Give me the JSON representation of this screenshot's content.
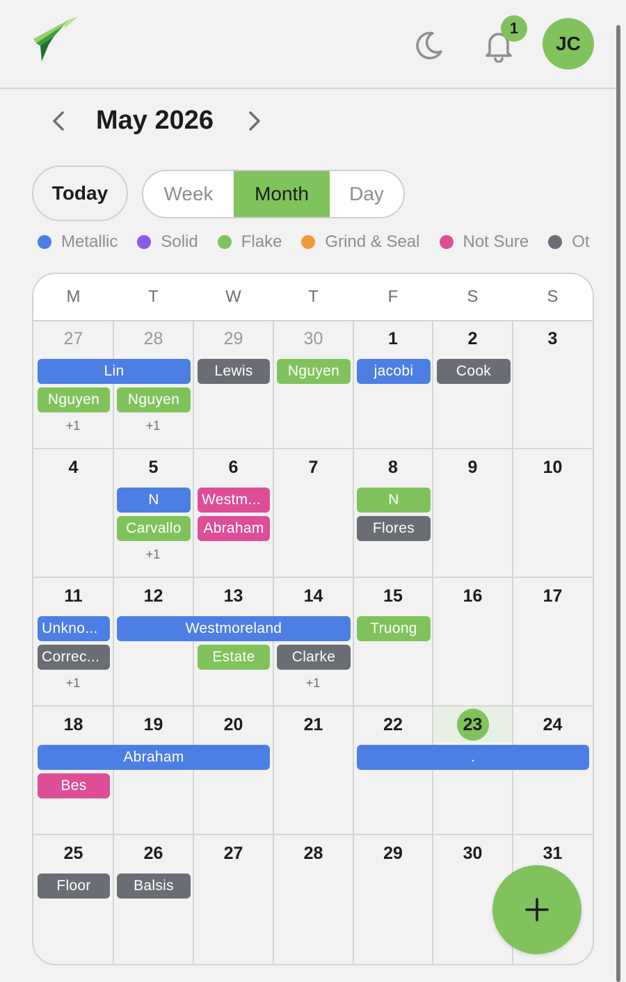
{
  "header": {
    "notification_count": "1",
    "avatar_initials": "JC"
  },
  "nav": {
    "month_title": "May 2026"
  },
  "view": {
    "today_label": "Today",
    "week_label": "Week",
    "month_label": "Month",
    "day_label": "Day",
    "selected": "Month"
  },
  "legend": [
    {
      "label": "Metallic",
      "color": "#4c7fe4"
    },
    {
      "label": "Solid",
      "color": "#8a5ce8"
    },
    {
      "label": "Flake",
      "color": "#80c35c"
    },
    {
      "label": "Grind & Seal",
      "color": "#ee9a3a"
    },
    {
      "label": "Not Sure",
      "color": "#de4e96"
    },
    {
      "label": "Ot",
      "color": "#6b6d75"
    }
  ],
  "weekdays": [
    "M",
    "T",
    "W",
    "T",
    "F",
    "S",
    "S"
  ],
  "weeks": [
    [
      "27",
      "28",
      "29",
      "30",
      "1",
      "2",
      "3"
    ],
    [
      "4",
      "5",
      "6",
      "7",
      "8",
      "9",
      "10"
    ],
    [
      "11",
      "12",
      "13",
      "14",
      "15",
      "16",
      "17"
    ],
    [
      "18",
      "19",
      "20",
      "21",
      "22",
      "23",
      "24"
    ],
    [
      "25",
      "26",
      "27",
      "28",
      "29",
      "30",
      "31"
    ]
  ],
  "today": "23",
  "events": {
    "w1_lin": "Lin",
    "w1_lewis": "Lewis",
    "w1_nguyen_thu": "Nguyen",
    "w1_jacobi": "jacobi",
    "w1_cook": "Cook",
    "w1_nguyen_mon": "Nguyen",
    "w1_nguyen_tue": "Nguyen",
    "w1_more_mon": "+1",
    "w1_more_tue": "+1",
    "w2_n_tue": "N",
    "w2_westm": "Westm...",
    "w2_n_fri": "N",
    "w2_carvallo": "Carvallo",
    "w2_abraham": "Abraham",
    "w2_flores": "Flores",
    "w2_more_tue": "+1",
    "w3_unkno": "Unkno...",
    "w3_westmoreland": "Westmoreland",
    "w3_truong": "Truong",
    "w3_correc": "Correc...",
    "w3_estate": "Estate",
    "w3_clarke": "Clarke",
    "w3_more_mon": "+1",
    "w3_more_thu": "+1",
    "w4_abraham": "Abraham",
    "w4_dot": ".",
    "w4_bes": "Bes",
    "w5_floor": "Floor",
    "w5_balsis": "Balsis"
  }
}
